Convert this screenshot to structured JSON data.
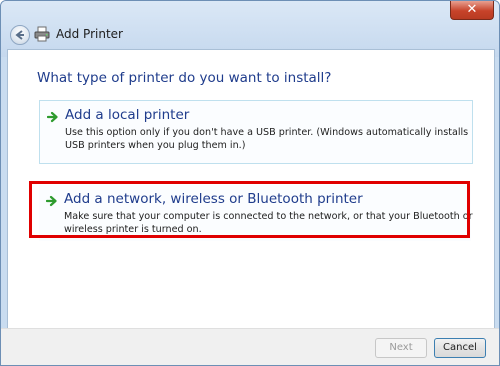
{
  "window": {
    "title": "Add Printer",
    "close_glyph": "✕"
  },
  "main": {
    "question": "What type of printer do you want to install?",
    "options": [
      {
        "title": "Add a local printer",
        "description": "Use this option only if you don't have a USB printer. (Windows automatically installs USB printers when you plug them in.)"
      },
      {
        "title": "Add a network, wireless or Bluetooth printer",
        "description": "Make sure that your computer is connected to the network, or that your Bluetooth or wireless printer is turned on."
      }
    ]
  },
  "footer": {
    "next_label": "Next",
    "cancel_label": "Cancel"
  },
  "colors": {
    "link_blue": "#1f3c8c",
    "arrow_green": "#2e9b2e",
    "highlight_red": "#e00000"
  },
  "icons": {
    "back": "back-arrow-icon",
    "printer": "printer-icon",
    "option_arrow": "green-arrow-icon",
    "close": "close-icon"
  }
}
